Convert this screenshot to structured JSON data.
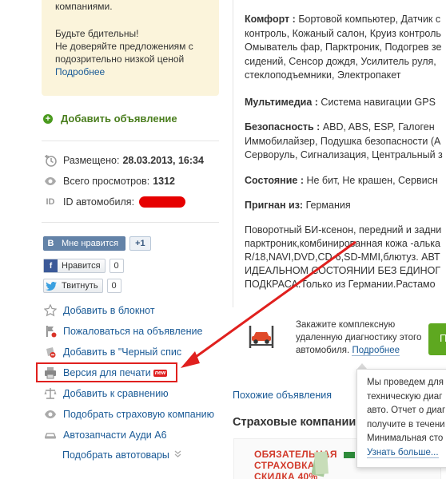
{
  "warning": {
    "line0": "компаниями.",
    "line1": "Будьте бдительны!",
    "line2": "Не доверяйте предложениям с",
    "line3": "подозрительно низкой ценой",
    "more": "Подробнее"
  },
  "add_ad": "Добавить объявление",
  "info": {
    "placed_label": "Размещено:",
    "placed_value": "28.03.2013, 16:34",
    "views_label": "Всего просмотров:",
    "views_value": "1312",
    "id_icon": "ID",
    "id_label": "ID автомобиля:"
  },
  "social": {
    "vk_label": "Мне нравится",
    "vk_icon": "В",
    "vk_count": "+1",
    "fb_label": "Нравится",
    "fb_icon": "f",
    "fb_count": "0",
    "tw_label": "Твитнуть",
    "tw_count": "0"
  },
  "actions": {
    "notepad": "Добавить в блокнот",
    "complain": "Пожаловаться на объявление",
    "blacklist": "Добавить в \"Черный спис",
    "print": "Версия для печати",
    "new_badge": "new",
    "compare": "Добавить к сравнению",
    "insurance": "Подобрать страховую компанию",
    "parts": "Автозапчасти Ауди А6",
    "goods": "Подобрать автотовары"
  },
  "specs": {
    "comfort_label": "Комфорт :",
    "comfort_lines": [
      "Бортовой компьютер, Датчик с",
      "контроль, Кожаный салон, Круиз контроль",
      "Омыватель фар, Парктроник, Подогрев зе",
      "сидений, Сенсор дождя, Усилитель руля,",
      "стеклоподъемники, Электропакет"
    ],
    "multimedia_label": "Мультимедиа :",
    "multimedia_value": "Система навигации GPS",
    "safety_label": "Безопасность :",
    "safety_lines": [
      "ABD, ABS, ESP, Галоген",
      "Иммобилайзер, Подушка безопасности (А",
      "Серворуль, Сигнализация, Центральный з"
    ],
    "state_label": "Состояние :",
    "state_value": "Не бит, Не крашен, Сервисн",
    "imported_label": "Пригнан из:",
    "imported_value": "Германия"
  },
  "description_lines": [
    "Поворотный БИ-ксенон, передний и задни",
    "парктроник,комбинированная кожа -алька",
    "R/18,NAVI,DVD,CD-6,SD-MMI,блютуз. АВТ",
    "ИДЕАЛЬНОМ СОСТОЯНИИ БЕЗ ЕДИНОГ",
    "ПОДКРАСА.Только из Германии.Растамо"
  ],
  "diagnostic": {
    "line1": "Закажите комплексную",
    "line2": "удаленную диагностику этого",
    "line3_prefix": "автомобиля.",
    "line3_link": "Подробнее",
    "button": "П"
  },
  "similar": "Похожие объявления",
  "insurance_title": "Страховые компании",
  "promo": {
    "line1": "ОБЯЗАТЕЛЬНАЯ",
    "line2": "СТРАХОВКА",
    "line3": "СКИДКА 40%"
  },
  "popup": {
    "lines": [
      "Мы проведем для",
      "техническую диаг",
      "авто. Отчет о диаг",
      "получите в течени",
      "Минимальная сто"
    ],
    "more": "Узнать больше..."
  },
  "colors": {
    "link": "#1a5a96",
    "highlight": "#e0201e",
    "add_green": "#4a7e1e",
    "warning_bg": "#fbf4db"
  }
}
